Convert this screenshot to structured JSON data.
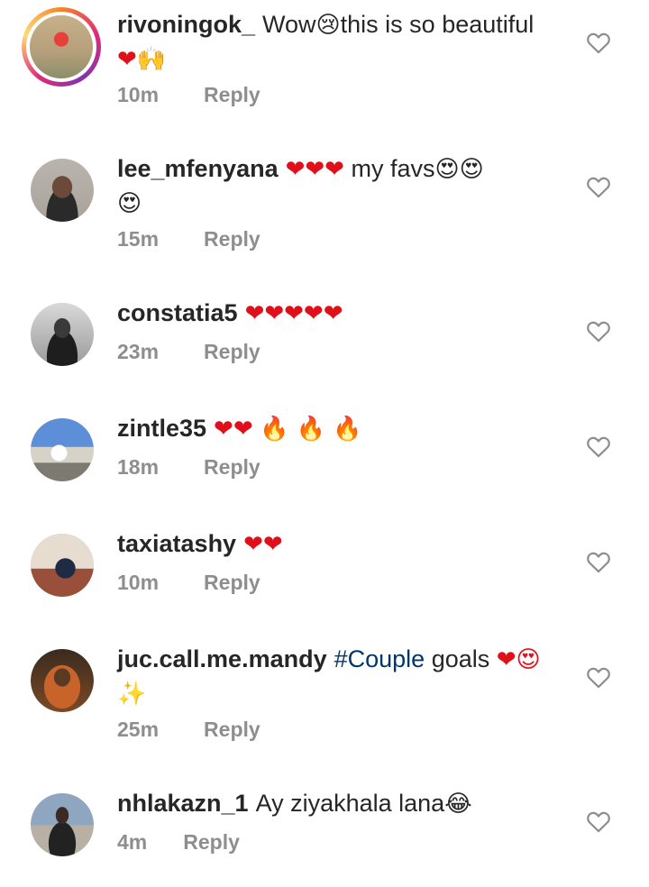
{
  "comments": [
    {
      "username": "rivoningok_",
      "text_a": "Wow",
      "emoji_a": "😢",
      "text_b": "this is so beautiful",
      "emoji_line2": "❤🙌",
      "time": "10m",
      "reply": "Reply"
    },
    {
      "username": "lee_mfenyana",
      "emoji_a": "❤❤❤",
      "text_b": "my favs",
      "emoji_b": "😍😍",
      "emoji_line2": "😍",
      "time": "15m",
      "reply": "Reply"
    },
    {
      "username": "constatia5",
      "emoji_a": "❤❤❤❤❤",
      "time": "23m",
      "reply": "Reply"
    },
    {
      "username": "zintle35",
      "emoji_a": "❤❤",
      "emoji_b": "🔥 🔥 🔥",
      "time": "18m",
      "reply": "Reply"
    },
    {
      "username": "taxiatashy",
      "emoji_a": "❤❤",
      "time": "10m",
      "reply": "Reply"
    },
    {
      "username": "juc.call.me.mandy",
      "hashtag": "#Couple",
      "text_b": "goals",
      "emoji_a": "❤😍",
      "emoji_line2": "✨",
      "time": "25m",
      "reply": "Reply"
    },
    {
      "username": "nhlakazn_1",
      "text_a": "Ay ziyakhala lana",
      "emoji_a": "😂",
      "time": "4m",
      "reply": "Reply"
    }
  ],
  "colors": {
    "username": "#262626",
    "meta": "#8e8e8e",
    "hashtag": "#00376b",
    "heart": "#e0101a",
    "like_icon": "#8e8e8e"
  },
  "icons": {
    "like": "heart-outline-icon"
  }
}
